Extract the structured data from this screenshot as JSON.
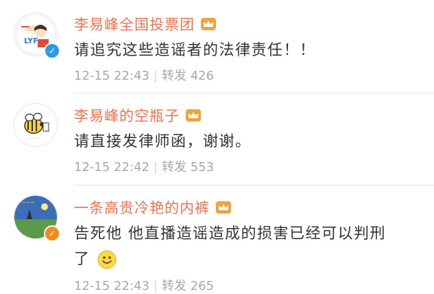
{
  "comments": [
    {
      "user": "李易峰全国投票团",
      "text": "请追究这些造谣者的法律责任！！",
      "time": "12-15 22:43",
      "forward_label": "转发",
      "forward_count": "426",
      "avatar_text": "LYF",
      "verified": "blue"
    },
    {
      "user": "李易峰的空瓶子",
      "text": "请直接发律师函，谢谢。",
      "time": "12-15 22:42",
      "forward_label": "转发",
      "forward_count": "553",
      "verified": "none"
    },
    {
      "user": "一条高贵冷艳的内裤",
      "text_line1": "告死他 他直播造谣造成的损害已经可以判刑",
      "text_line2": "了",
      "time": "12-15 22:43",
      "forward_label": "转发",
      "forward_count": "265",
      "verified": "orange"
    }
  ],
  "colors": {
    "username": "#eb7350",
    "meta": "#a8a8a8",
    "verified_blue": "#2d9ae8",
    "verified_orange": "#f08a1d",
    "crown": "#f0a23c"
  },
  "icons": [
    "crown-icon",
    "verified-icon",
    "smile-emoji-icon"
  ]
}
